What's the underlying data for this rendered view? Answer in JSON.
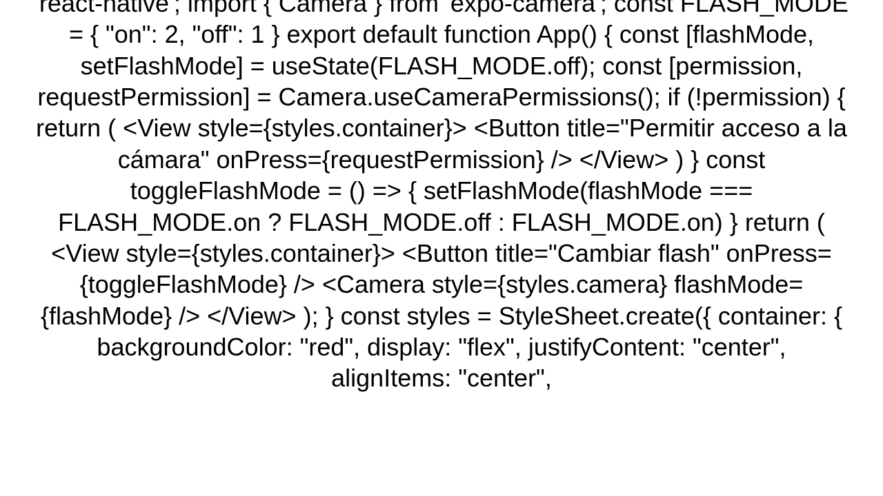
{
  "code_text": "'react-native'; import { Camera } from 'expo-camera';  const FLASH_MODE = {   \"on\": 2,   \"off\": 1 }  export default function App() {   const [flashMode, setFlashMode] = useState(FLASH_MODE.off);   const [permission, requestPermission] = Camera.useCameraPermissions();    if (!permission) {     return (       <View style={styles.container}>         <Button title=\"Permitir acceso a la cámara\" onPress={requestPermission} />       </View>     )   }    const toggleFlashMode = () => {     setFlashMode(flashMode === FLASH_MODE.on ? FLASH_MODE.off : FLASH_MODE.on)   }    return (     <View style={styles.container}>       <Button title=\"Cambiar flash\" onPress={toggleFlashMode} />       <Camera style={styles.camera} flashMode={flashMode} />     </View>   ); }  const styles = StyleSheet.create({   container: {     backgroundColor: \"red\",     display: \"flex\",     justifyContent: \"center\",     alignItems: \"center\","
}
